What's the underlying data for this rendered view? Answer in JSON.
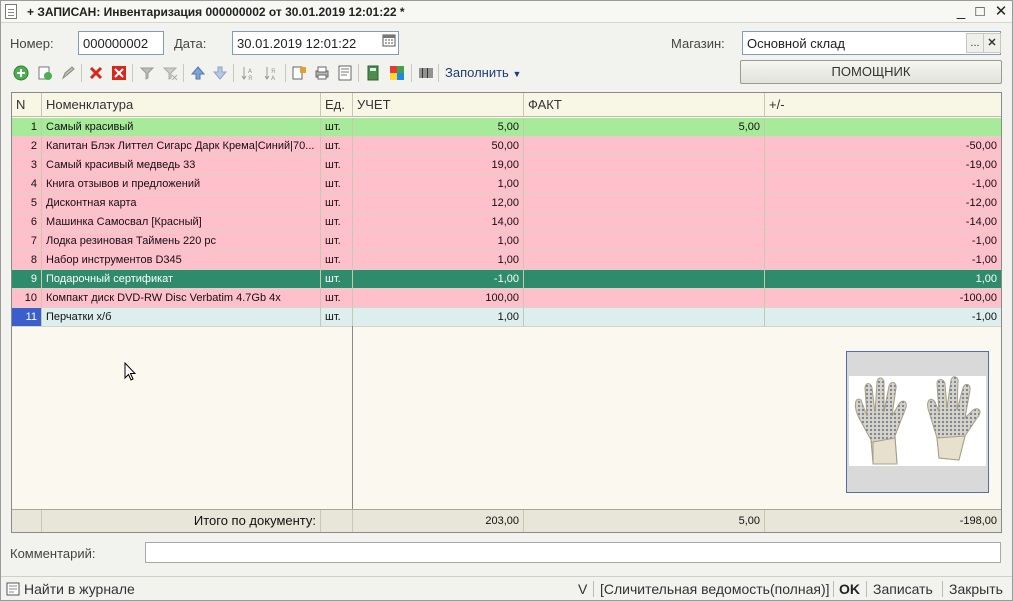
{
  "window": {
    "title": "+ ЗАПИСАН: Инвентаризация 000000002 от 30.01.2019 12:01:22 *",
    "minimize": "_",
    "maximize": "□",
    "close": "✕"
  },
  "header": {
    "number_label": "Номер:",
    "number_value": "000000002",
    "date_label": "Дата:",
    "date_value": "30.01.2019 12:01:22",
    "store_label": "Магазин:",
    "store_value": "Основной склад",
    "store_select_btn": "...",
    "store_clear_btn": "✕",
    "helper_button": "ПОМОЩНИК"
  },
  "toolbar": {
    "fill_label": "Заполнить"
  },
  "table": {
    "columns": [
      "N",
      "Номенклатура",
      "Ед.",
      "УЧЕТ",
      "ФАКТ",
      "+/-"
    ],
    "rows": [
      {
        "n": "1",
        "name": "Самый красивый",
        "unit": "шт.",
        "account": "5,00",
        "fact": "5,00",
        "diff": "",
        "style": "green"
      },
      {
        "n": "2",
        "name": "Капитан Блэк Литтел Сигарс Дарк Крема|Синий|70...",
        "unit": "шт.",
        "account": "50,00",
        "fact": "",
        "diff": "-50,00",
        "style": "pink"
      },
      {
        "n": "3",
        "name": "Самый красивый медведь 33",
        "unit": "шт.",
        "account": "19,00",
        "fact": "",
        "diff": "-19,00",
        "style": "pink"
      },
      {
        "n": "4",
        "name": "Книга отзывов и предложений",
        "unit": "шт.",
        "account": "1,00",
        "fact": "",
        "diff": "-1,00",
        "style": "pink"
      },
      {
        "n": "5",
        "name": "Дисконтная карта",
        "unit": "шт.",
        "account": "12,00",
        "fact": "",
        "diff": "-12,00",
        "style": "pink"
      },
      {
        "n": "6",
        "name": "Машинка Самосвал [Красный]",
        "unit": "шт.",
        "account": "14,00",
        "fact": "",
        "diff": "-14,00",
        "style": "pink"
      },
      {
        "n": "7",
        "name": "Лодка резиновая Таймень 220 рс",
        "unit": "шт.",
        "account": "1,00",
        "fact": "",
        "diff": "-1,00",
        "style": "pink"
      },
      {
        "n": "8",
        "name": "Набор инструментов D345",
        "unit": "шт.",
        "account": "1,00",
        "fact": "",
        "diff": "-1,00",
        "style": "pink"
      },
      {
        "n": "9",
        "name": "Подарочный сертификат",
        "unit": "шт.",
        "account": "-1,00",
        "fact": "",
        "diff": "1,00",
        "style": "dark"
      },
      {
        "n": "10",
        "name": "Компакт диск DVD-RW Disc Verbatim 4.7Gb 4x",
        "unit": "шт.",
        "account": "100,00",
        "fact": "",
        "diff": "-100,00",
        "style": "pink"
      },
      {
        "n": "11",
        "name": "Перчатки х/б",
        "unit": "шт.",
        "account": "1,00",
        "fact": "",
        "diff": "-1,00",
        "style": "light"
      }
    ],
    "totals": {
      "label": "Итого по документу:",
      "account": "203,00",
      "fact": "5,00",
      "diff": "-198,00"
    }
  },
  "comment": {
    "label": "Комментарий:",
    "value": ""
  },
  "statusbar": {
    "find_in_journal": "Найти в журнале",
    "v": "V",
    "report": "[Сличительная ведомость(полная)]",
    "ok": "OK",
    "save": "Записать",
    "close": "Закрыть"
  },
  "colors": {
    "pink": "#ffc0cb",
    "green": "#a7ea9a",
    "dark": "#2e8b6c",
    "light": "#dceeed",
    "header": "#f8f7e6"
  }
}
